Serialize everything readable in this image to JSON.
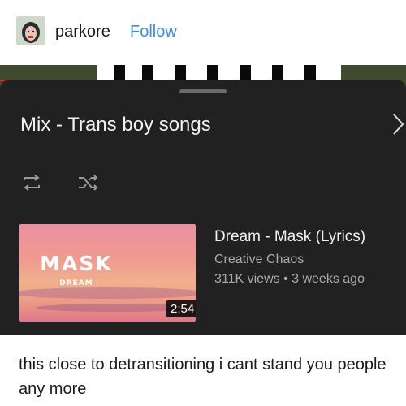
{
  "post": {
    "username": "parkore",
    "follow_label": "Follow",
    "caption": "this close to detransitioning i cant stand you people any more"
  },
  "playlist": {
    "title": "Mix - Trans boy songs"
  },
  "video": {
    "title": "Dream - Mask (Lyrics)",
    "channel": "Creative Chaos",
    "meta": "311K views • 3 weeks ago",
    "duration": "2:54",
    "thumbnail_title": "MASK",
    "thumbnail_subtitle": "DREAM"
  },
  "icons": {
    "loop": "loop-icon",
    "shuffle": "shuffle-icon",
    "chevron": "chevron-right-icon"
  },
  "colors": {
    "follow": "#3a8ee6",
    "sheet_background": "#212121",
    "secondary_text": "#aaaaaa"
  }
}
